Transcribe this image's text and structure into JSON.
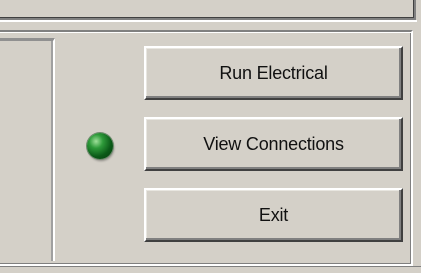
{
  "buttons": {
    "run_electrical": "Run Electrical",
    "view_connections": "View Connections",
    "exit": "Exit"
  },
  "status_indicator": {
    "state": "on",
    "color": "#0b5a18"
  },
  "theme": {
    "face_color": "#d4d0c8"
  }
}
